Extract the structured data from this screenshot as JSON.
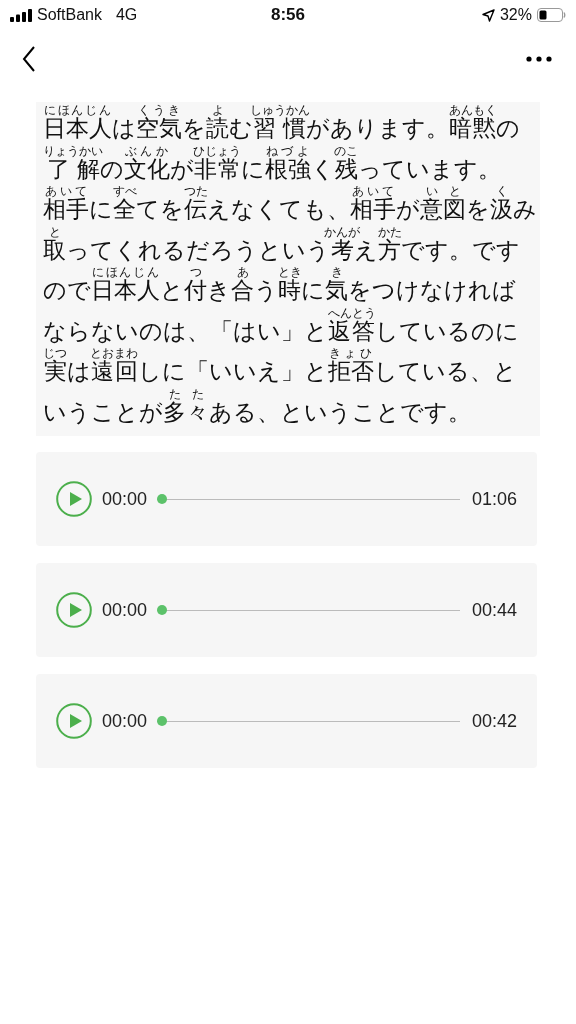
{
  "status_bar": {
    "carrier": "SoftBank",
    "network": "4G",
    "time": "8:56",
    "battery": "32%"
  },
  "article": {
    "segments": [
      {
        "text": "日本人",
        "reading": "にほんじん"
      },
      {
        "text": "は"
      },
      {
        "text": "空気",
        "reading": "くうき"
      },
      {
        "text": "を"
      },
      {
        "text": "読",
        "reading": "よ"
      },
      {
        "text": "む"
      },
      {
        "text": "習慣",
        "reading": "しゅうかん"
      },
      {
        "text": "があります。"
      },
      {
        "text": "暗黙",
        "reading": "あんもく"
      },
      {
        "text": "の"
      },
      {
        "text": "了解",
        "reading": "りょうかい"
      },
      {
        "text": "の"
      },
      {
        "text": "文化",
        "reading": "ぶんか"
      },
      {
        "text": "が"
      },
      {
        "text": "非常",
        "reading": "ひじょう"
      },
      {
        "text": "に"
      },
      {
        "text": "根強",
        "reading": "ねづよ"
      },
      {
        "text": "く"
      },
      {
        "text": "残",
        "reading": "のこ"
      },
      {
        "text": "っています。"
      },
      {
        "text": "相手",
        "reading": "あいて"
      },
      {
        "text": "に"
      },
      {
        "text": "全",
        "reading": "すべ"
      },
      {
        "text": "てを"
      },
      {
        "text": "伝",
        "reading": "つた"
      },
      {
        "text": "えなくても、"
      },
      {
        "text": "相手",
        "reading": "あいて"
      },
      {
        "text": "が"
      },
      {
        "text": "意図",
        "reading": "いと"
      },
      {
        "text": "を"
      },
      {
        "text": "汲",
        "reading": "く"
      },
      {
        "text": "み"
      },
      {
        "text": "取",
        "reading": "と"
      },
      {
        "text": "ってくれるだろうという"
      },
      {
        "text": "考",
        "reading": "かんが"
      },
      {
        "text": "え"
      },
      {
        "text": "方",
        "reading": "かた"
      },
      {
        "text": "です。ですので"
      },
      {
        "text": "日本人",
        "reading": "にほんじん"
      },
      {
        "text": "と"
      },
      {
        "text": "付",
        "reading": "つ"
      },
      {
        "text": "き"
      },
      {
        "text": "合",
        "reading": "あ"
      },
      {
        "text": "う"
      },
      {
        "text": "時",
        "reading": "とき"
      },
      {
        "text": "に"
      },
      {
        "text": "気",
        "reading": "き"
      },
      {
        "text": "をつけなければならないのは、「はい」と"
      },
      {
        "text": "返答",
        "reading": "へんとう"
      },
      {
        "text": "しているのに"
      },
      {
        "text": "実",
        "reading": "じつ"
      },
      {
        "text": "は"
      },
      {
        "text": "遠回",
        "reading": "とおまわ"
      },
      {
        "text": "しに「いいえ」と"
      },
      {
        "text": "拒否",
        "reading": "きょひ"
      },
      {
        "text": "している、ということが"
      },
      {
        "text": "多々",
        "reading": "たた"
      },
      {
        "text": "ある、ということです。"
      }
    ]
  },
  "players": [
    {
      "elapsed": "00:00",
      "duration": "01:06",
      "level": 0
    },
    {
      "elapsed": "00:00",
      "duration": "00:44",
      "level": 0
    },
    {
      "elapsed": "00:00",
      "duration": "00:42",
      "level": 0
    }
  ]
}
